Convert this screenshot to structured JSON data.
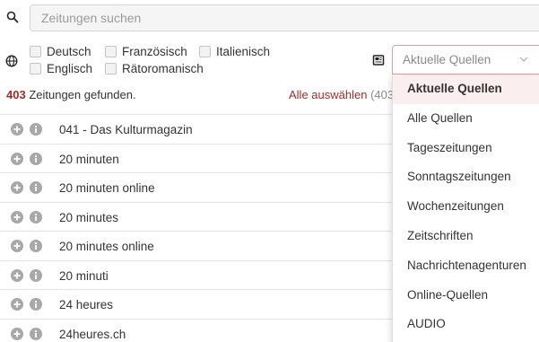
{
  "search": {
    "placeholder": "Zeitungen suchen"
  },
  "languages": {
    "options": [
      {
        "label": "Deutsch",
        "checked": false
      },
      {
        "label": "Französisch",
        "checked": false
      },
      {
        "label": "Italienisch",
        "checked": false
      },
      {
        "label": "Englisch",
        "checked": false
      },
      {
        "label": "Rätoromanisch",
        "checked": false
      }
    ]
  },
  "source_filter": {
    "selected": "Aktuelle Quellen",
    "options": [
      "Aktuelle Quellen",
      "Alle Quellen",
      "Tageszeitungen",
      "Sonntagszeitungen",
      "Wochenzeitungen",
      "Zeitschriften",
      "Nachrichtenagenturen",
      "Online-Quellen",
      "AUDIO"
    ]
  },
  "results": {
    "count": "403",
    "count_text": " Zeitungen gefunden.",
    "select_all_label": "Alle auswählen",
    "select_all_count": "(403"
  },
  "newspapers": [
    "041 - Das Kulturmagazin",
    "20 minuten",
    "20 minuten online",
    "20 minutes",
    "20 minutes online",
    "20 minuti",
    "24 heures",
    "24heures.ch"
  ],
  "colors": {
    "accent": "#a52a2a",
    "active_bg": "#fbeeee",
    "icon_grey": "#a8a8a8"
  }
}
